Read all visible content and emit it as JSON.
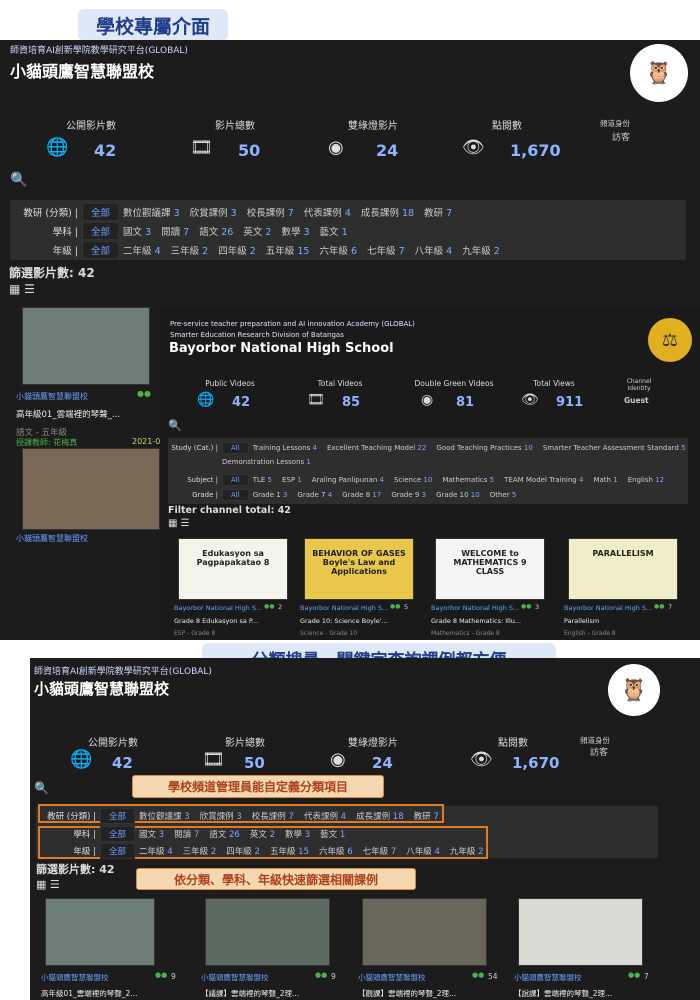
{
  "top_title": "學校專屬介面",
  "mid_title": "分類搜尋、關鍵字查詢課例都方便",
  "callout1": "學校頻道管理員能自定義分類項目",
  "callout2": "依分類、學科、年級快速篩選相關課例",
  "zh": {
    "org": "師資培育AI創新學院教學研究平台(GLOBAL)",
    "org2": "師資培育AI創新學院教學研究平台(GLOBAL)",
    "name": "小貓頭鷹智慧聯盟校",
    "stats": [
      {
        "label": "公開影片數",
        "value": "42"
      },
      {
        "label": "影片總數",
        "value": "50"
      },
      {
        "label": "雙綠燈影片",
        "value": "24"
      },
      {
        "label": "點閱數",
        "value": "1,670"
      }
    ],
    "identity_label": "頻道身份",
    "identity": "訪客",
    "all": "全部",
    "row1": {
      "label": "教研 (分類) |",
      "items": [
        [
          "數位觀議課",
          "3"
        ],
        [
          "欣賞課例",
          "3"
        ],
        [
          "校長課例",
          "7"
        ],
        [
          "代表課例",
          "4"
        ],
        [
          "成長課例",
          "18"
        ],
        [
          "教研",
          "7"
        ]
      ]
    },
    "row2": {
      "label": "學科 |",
      "items": [
        [
          "國文",
          "3"
        ],
        [
          "閱讀",
          "7"
        ],
        [
          "語文",
          "26"
        ],
        [
          "英文",
          "2"
        ],
        [
          "數學",
          "3"
        ],
        [
          "藝文",
          "1"
        ]
      ]
    },
    "row3": {
      "label": "年級 |",
      "items": [
        [
          "二年級",
          "4"
        ],
        [
          "三年級",
          "2"
        ],
        [
          "四年級",
          "2"
        ],
        [
          "五年級",
          "15"
        ],
        [
          "六年級",
          "6"
        ],
        [
          "七年級",
          "7"
        ],
        [
          "八年級",
          "4"
        ],
        [
          "九年級",
          "2"
        ]
      ]
    },
    "filter_total": "篩選影片數: 42",
    "card_channel": "小貓頭鷹智慧聯盟校",
    "card1_title": "高年級01_雲端裡的琴聲_...",
    "card1_sub": "語文 - 五年級",
    "card2_teacher": "授課教師: 花梅真",
    "card2_date": "2021-0",
    "bottom_cards": [
      {
        "title": "高年級01_雲端裡的琴聲_2...",
        "views": "9"
      },
      {
        "title": "【議課】雲端裡的琴聲_2理...",
        "views": "9"
      },
      {
        "title": "【觀課】雲端裡的琴聲_2理...",
        "views": "54"
      },
      {
        "title": "【說課】雲端裡的琴聲_2理...",
        "views": "7"
      }
    ]
  },
  "en": {
    "org1": "Pre-service teacher preparation and AI innovation Academy (GLOBAL)",
    "org2": "Smarter Education Research Division of Batangas",
    "name": "Bayorbor National High School",
    "stats": [
      {
        "label": "Public Videos",
        "value": "42"
      },
      {
        "label": "Total Videos",
        "value": "85"
      },
      {
        "label": "Double Green Videos",
        "value": "81"
      },
      {
        "label": "Total Views",
        "value": "911"
      }
    ],
    "identity_label": "Channel Identity",
    "identity": "Guest",
    "all": "All",
    "row1_label": "Study (Cat.) |",
    "row1": [
      [
        "Training Lessons",
        "4"
      ],
      [
        "Excellent Teaching Model",
        "22"
      ],
      [
        "Good Teaching Practices",
        "10"
      ],
      [
        "Smarter Teacher Assessment Standard",
        "5"
      ]
    ],
    "row1b": [
      [
        "Demonstration Lessons",
        "1"
      ]
    ],
    "row2_label": "Subject |",
    "row2": [
      [
        "TLE",
        "5"
      ],
      [
        "ESP",
        "1"
      ],
      [
        "Araling Panlipunan",
        "4"
      ],
      [
        "Science",
        "10"
      ],
      [
        "Mathematics",
        "5"
      ],
      [
        "TEAM Model Training",
        "4"
      ],
      [
        "Math",
        "1"
      ],
      [
        "English",
        "12"
      ]
    ],
    "row3_label": "Grade |",
    "row3": [
      [
        "Grade 1",
        "3"
      ],
      [
        "Grade 7",
        "4"
      ],
      [
        "Grade 8",
        "17"
      ],
      [
        "Grade 9",
        "3"
      ],
      [
        "Grade 10",
        "10"
      ],
      [
        "Other",
        "5"
      ]
    ],
    "filter_total": "Filter channel total: 42",
    "cards": [
      {
        "thumb": "Edukasyon sa Pagpapakatao 8",
        "channel": "Bayorbor National High S...",
        "views": "2",
        "title": "Grade 8 Edukasyon sa P...",
        "sub": "ESP - Grade 8"
      },
      {
        "thumb": "BEHAVIOR OF GASES Boyle's Law and Applications",
        "channel": "Bayorbor National High S...",
        "views": "5",
        "title": "Grade 10: Science Boyle'...",
        "sub": "Science - Grade 10"
      },
      {
        "thumb": "WELCOME to MATHEMATICS 9 CLASS",
        "channel": "Bayorbor National High S...",
        "views": "3",
        "title": "Grade 8 Mathematics: Illu...",
        "sub": "Mathematics - Grade 8"
      },
      {
        "thumb": "PARALLELISM",
        "channel": "Bayorbor National High S...",
        "views": "7",
        "title": "Parallelism",
        "sub": "English - Grade 8"
      }
    ]
  }
}
